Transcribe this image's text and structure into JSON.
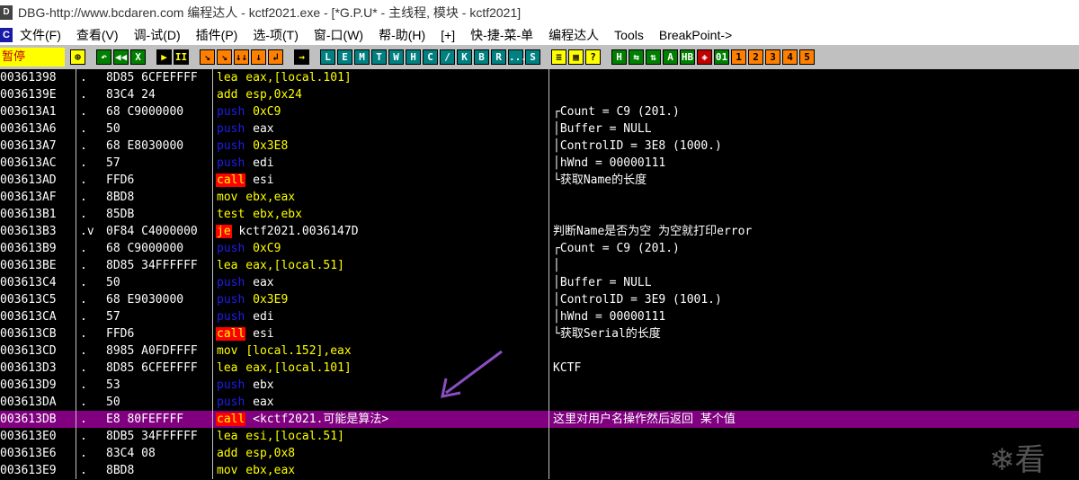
{
  "title": "DBG-http://www.bcdaren.com 编程达人 - kctf2021.exe - [*G.P.U* -  主线程, 模块 - kctf2021]",
  "menu": [
    "文件(F)",
    "查看(V)",
    "调-试(D)",
    "插件(P)",
    "选-项(T)",
    "窗-口(W)",
    "帮-助(H)",
    "[+]",
    "快-捷-菜-单",
    "编程达人",
    "Tools",
    "BreakPoint->"
  ],
  "toolbar": {
    "status": "暂停",
    "buttons": [
      "⊕",
      "↶",
      "◀◀",
      "X",
      "▶",
      "II",
      "↘",
      "↘",
      "↓↓",
      "↓",
      "↲",
      "→",
      "L",
      "E",
      "M",
      "T",
      "W",
      "H",
      "C",
      "/",
      "K",
      "B",
      "R",
      "...",
      "S",
      "≡",
      "▦",
      "?",
      "H",
      "⇆",
      "⇅",
      "A",
      "HB",
      "◈",
      "01",
      "1",
      "2",
      "3",
      "4",
      "5"
    ]
  },
  "rows": [
    {
      "addr": "00361398",
      "mark": ".",
      "hex": "8D85 6CFEFFFF",
      "asm": [
        {
          "t": "lea",
          "k": "lea"
        },
        {
          "t": " eax,"
        },
        {
          "t": "[local.101]",
          "c": "br"
        }
      ],
      "com": ""
    },
    {
      "addr": "0036139E",
      "mark": ".",
      "hex": "83C4 24",
      "asm": [
        {
          "t": "add",
          "k": "add"
        },
        {
          "t": " esp,"
        },
        {
          "t": "0x24",
          "c": "num"
        }
      ],
      "com": ""
    },
    {
      "addr": "003613A1",
      "mark": ".",
      "hex": "68 C9000000",
      "asm": [
        {
          "t": "push",
          "k": "push"
        },
        {
          "t": " "
        },
        {
          "t": "0xC9",
          "c": "num"
        }
      ],
      "com": "┌Count = C9 (201.)"
    },
    {
      "addr": "003613A6",
      "mark": ".",
      "hex": "50",
      "asm": [
        {
          "t": "push",
          "k": "push"
        },
        {
          "t": " eax"
        }
      ],
      "com": "│Buffer = NULL"
    },
    {
      "addr": "003613A7",
      "mark": ".",
      "hex": "68 E8030000",
      "asm": [
        {
          "t": "push",
          "k": "push"
        },
        {
          "t": " "
        },
        {
          "t": "0x3E8",
          "c": "num"
        }
      ],
      "com": "│ControlID = 3E8 (1000.)"
    },
    {
      "addr": "003613AC",
      "mark": ".",
      "hex": "57",
      "asm": [
        {
          "t": "push",
          "k": "push"
        },
        {
          "t": " edi"
        }
      ],
      "com": "│hWnd = 00000111"
    },
    {
      "addr": "003613AD",
      "mark": ".",
      "hex": "FFD6",
      "asm": [
        {
          "t": "call",
          "k": "call"
        },
        {
          "t": " esi"
        }
      ],
      "com": "└获取Name的长度"
    },
    {
      "addr": "003613AF",
      "mark": ".",
      "hex": "8BD8",
      "asm": [
        {
          "t": "mov",
          "k": "mov"
        },
        {
          "t": " ebx,eax"
        }
      ],
      "com": ""
    },
    {
      "addr": "003613B1",
      "mark": ".",
      "hex": "85DB",
      "asm": [
        {
          "t": "test",
          "k": "test"
        },
        {
          "t": " ebx,ebx"
        }
      ],
      "com": ""
    },
    {
      "addr": "003613B3",
      "mark": ".v",
      "hex": "0F84 C4000000",
      "asm": [
        {
          "t": "je",
          "k": "je"
        },
        {
          "t": " kctf2021.0036147D"
        }
      ],
      "com": "判断Name是否为空 为空就打印error"
    },
    {
      "addr": "003613B9",
      "mark": ".",
      "hex": "68 C9000000",
      "asm": [
        {
          "t": "push",
          "k": "push"
        },
        {
          "t": " "
        },
        {
          "t": "0xC9",
          "c": "num"
        }
      ],
      "com": "┌Count = C9 (201.)"
    },
    {
      "addr": "003613BE",
      "mark": ".",
      "hex": "8D85 34FFFFFF",
      "asm": [
        {
          "t": "lea",
          "k": "lea"
        },
        {
          "t": " eax,"
        },
        {
          "t": "[local.51]",
          "c": "br"
        }
      ],
      "com": "│"
    },
    {
      "addr": "003613C4",
      "mark": ".",
      "hex": "50",
      "asm": [
        {
          "t": "push",
          "k": "push"
        },
        {
          "t": " eax"
        }
      ],
      "com": "│Buffer = NULL"
    },
    {
      "addr": "003613C5",
      "mark": ".",
      "hex": "68 E9030000",
      "asm": [
        {
          "t": "push",
          "k": "push"
        },
        {
          "t": " "
        },
        {
          "t": "0x3E9",
          "c": "num"
        }
      ],
      "com": "│ControlID = 3E9 (1001.)"
    },
    {
      "addr": "003613CA",
      "mark": ".",
      "hex": "57",
      "asm": [
        {
          "t": "push",
          "k": "push"
        },
        {
          "t": " edi"
        }
      ],
      "com": "│hWnd = 00000111"
    },
    {
      "addr": "003613CB",
      "mark": ".",
      "hex": "FFD6",
      "asm": [
        {
          "t": "call",
          "k": "call"
        },
        {
          "t": " esi"
        }
      ],
      "com": "└获取Serial的长度"
    },
    {
      "addr": "003613CD",
      "mark": ".",
      "hex": "8985 A0FDFFFF",
      "asm": [
        {
          "t": "mov",
          "k": "mov"
        },
        {
          "t": " "
        },
        {
          "t": "[local.152]",
          "c": "br"
        },
        {
          "t": ",eax"
        }
      ],
      "com": ""
    },
    {
      "addr": "003613D3",
      "mark": ".",
      "hex": "8D85 6CFEFFFF",
      "asm": [
        {
          "t": "lea",
          "k": "lea"
        },
        {
          "t": " eax,"
        },
        {
          "t": "[local.101]",
          "c": "br"
        }
      ],
      "com": "KCTF"
    },
    {
      "addr": "003613D9",
      "mark": ".",
      "hex": "53",
      "asm": [
        {
          "t": "push",
          "k": "push"
        },
        {
          "t": " ebx"
        }
      ],
      "com": ""
    },
    {
      "addr": "003613DA",
      "mark": ".",
      "hex": "50",
      "asm": [
        {
          "t": "push",
          "k": "push"
        },
        {
          "t": " eax"
        }
      ],
      "com": ""
    },
    {
      "addr": "003613DB",
      "mark": ".",
      "hex": "E8 80FEFFFF",
      "asm": [
        {
          "t": "call",
          "k": "call"
        },
        {
          "t": " <kctf2021.可能是算法>"
        }
      ],
      "com": "这里对用户名操作然后返回 某个值",
      "hl": true
    },
    {
      "addr": "003613E0",
      "mark": ".",
      "hex": "8DB5 34FFFFFF",
      "asm": [
        {
          "t": "lea",
          "k": "lea"
        },
        {
          "t": " esi,"
        },
        {
          "t": "[local.51]",
          "c": "br"
        }
      ],
      "com": ""
    },
    {
      "addr": "003613E6",
      "mark": ".",
      "hex": "83C4 08",
      "asm": [
        {
          "t": "add",
          "k": "add"
        },
        {
          "t": " esp,"
        },
        {
          "t": "0x8",
          "c": "num"
        }
      ],
      "com": ""
    },
    {
      "addr": "003613E9",
      "mark": ".",
      "hex": "8BD8",
      "asm": [
        {
          "t": "mov",
          "k": "mov"
        },
        {
          "t": " ebx,eax"
        }
      ],
      "com": ""
    }
  ],
  "colors": {
    "highlight": "#800080",
    "push": "#1e1ee8",
    "call_bg": "#ff0000",
    "operand": "#ffff00"
  }
}
